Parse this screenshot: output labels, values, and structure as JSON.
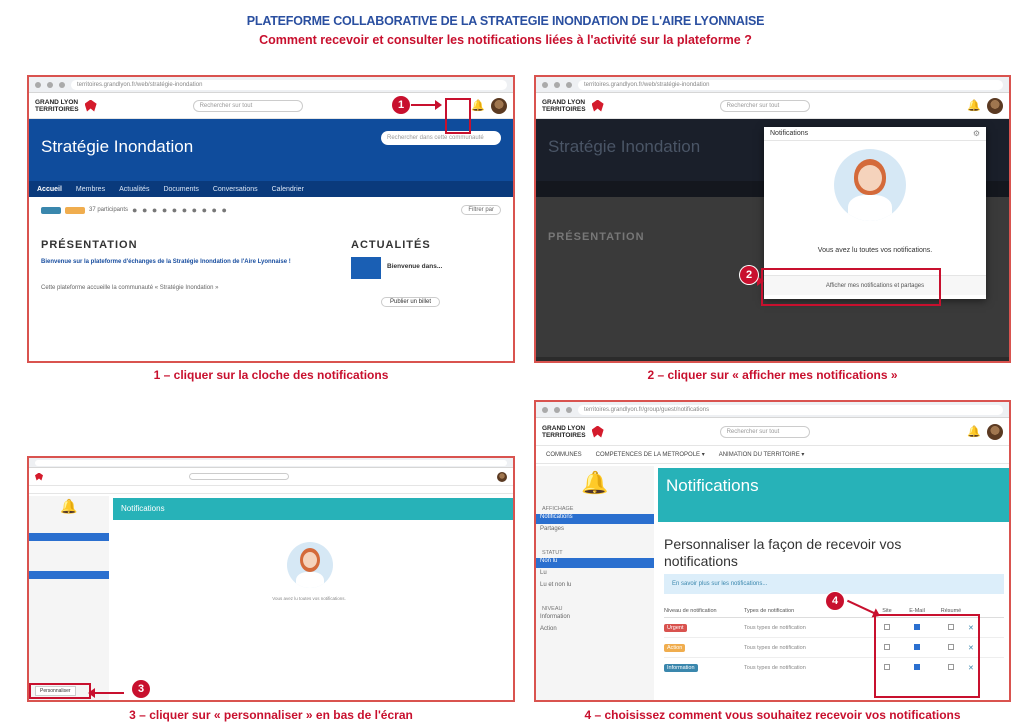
{
  "header": {
    "title": "PLATEFORME COLLABORATIVE DE LA STRATEGIE INONDATION DE L'AIRE LYONNAISE",
    "subtitle": "Comment recevoir et consulter les notifications liées à l'activité sur la plateforme ?"
  },
  "colors": {
    "title_blue": "#2a4fa0",
    "accent_red": "#c8102e",
    "brand_blue": "#0f4c9c",
    "teal": "#27b2b8"
  },
  "steps": {
    "s1": {
      "caption": "1 – cliquer sur la cloche des notifications",
      "badge": "1"
    },
    "s2": {
      "caption": "2 – cliquer sur « afficher mes notifications »",
      "badge": "2"
    },
    "s3": {
      "caption": "3 – cliquer sur « personnaliser » en bas de l'écran",
      "badge": "3"
    },
    "s4": {
      "caption": "4 – choisissez comment vous souhaitez recevoir vos notifications",
      "badge": "4"
    }
  },
  "panel1": {
    "logo_line1": "GRAND LYON",
    "logo_line2": "TERRITOIRES",
    "search_placeholder": "Rechercher sur tout",
    "space_title": "Stratégie Inondation",
    "space_search": "Rechercher dans cette communauté",
    "nav": [
      "Accueil",
      "Membres",
      "Actualités",
      "Documents",
      "Conversations",
      "Calendrier"
    ],
    "participants": "37 participants",
    "filter": "Filtrer par",
    "presentation": "PRÉSENTATION",
    "presentation_text": "Bienvenue sur la plateforme d'échanges de la Stratégie Inondation de l'Aire Lyonnaise !",
    "presentation_text2": "Cette plateforme accueille la communauté « Stratégie Inondation »",
    "news": "ACTUALITÉS",
    "news_item": "Bienvenue dans...",
    "publish": "Publier un billet"
  },
  "panel2": {
    "notif_header": "Notifications",
    "empty_text": "Vous avez lu toutes vos notifications.",
    "show_button": "Afficher mes notifications et partages",
    "presentation": "PRÉSENTATION"
  },
  "panel3": {
    "header": "Notifications",
    "empty_text": "Vous avez lu toutes vos notifications.",
    "personalize": "Personnaliser"
  },
  "panel4": {
    "nav": [
      "COMMUNES",
      "COMPETENCES DE LA METROPOLE ▾",
      "ANIMATION DU TERRITOIRE ▾"
    ],
    "header": "Notifications",
    "side_section1": "AFFICHAGE",
    "side_items1": [
      "Notifications",
      "Partages"
    ],
    "side_section2": "STATUT",
    "side_items2": [
      "Non lu",
      "Lu",
      "Lu et non lu"
    ],
    "side_section3": "NIVEAU",
    "side_items3": [
      "Information",
      "Action"
    ],
    "heading": "Personnaliser la façon de recevoir vos notifications",
    "dropdown": "En savoir plus sur les notifications...",
    "col_level": "Niveau de notification",
    "col_type": "Types de notification",
    "col_site": "Site",
    "col_email": "E-Mail",
    "col_digest": "Résumé",
    "rows": [
      {
        "level": "Urgent",
        "color": "#d9534f",
        "type": "Tous types de notification",
        "site": false,
        "email": true,
        "digest": false
      },
      {
        "level": "Action",
        "color": "#f0ad4e",
        "type": "Tous types de notification",
        "site": false,
        "email": true,
        "digest": false
      },
      {
        "level": "Information",
        "color": "#3a87ad",
        "type": "Tous types de notification",
        "site": false,
        "email": true,
        "digest": false
      }
    ]
  }
}
